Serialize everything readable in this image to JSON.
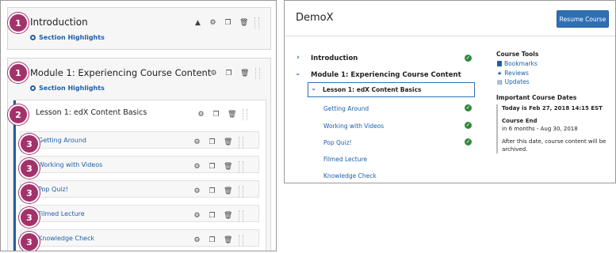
{
  "studio": {
    "section": {
      "badge": "1",
      "title": "Introduction",
      "highlights": "Section Highlights"
    },
    "module": {
      "badge": "1",
      "title": "Module 1: Experiencing Course Content",
      "highlights": "Section Highlights"
    },
    "lesson": {
      "badge": "2",
      "title": "Lesson 1: edX Content Basics"
    },
    "units": [
      {
        "badge": "3",
        "title": "Getting Around"
      },
      {
        "badge": "3",
        "title": "Working with Videos"
      },
      {
        "badge": "3",
        "title": "Pop Quiz!"
      },
      {
        "badge": "3",
        "title": "Filmed Lecture"
      },
      {
        "badge": "3",
        "title": "Knowledge Check"
      }
    ]
  },
  "lms": {
    "course_title": "DemoX",
    "resume_label": "Resume Course",
    "outline": {
      "intro": "Introduction",
      "module": "Module 1: Experiencing Course Content",
      "lesson": "Lesson 1: edX Content Basics",
      "units": [
        "Getting Around",
        "Working with Videos",
        "Pop Quiz!",
        "Filmed Lecture",
        "Knowledge Check"
      ]
    },
    "tools": {
      "heading": "Course Tools",
      "items": [
        "Bookmarks",
        "Reviews",
        "Updates"
      ]
    },
    "dates": {
      "heading": "Important Course Dates",
      "today": "Today is Feb 27, 2018 14:15 EST",
      "end_label": "Course End",
      "end_value": "in 6 months - Aug 30, 2018",
      "note": "After this date, course content will be archived."
    }
  },
  "colors": {
    "badge": "#a3326b",
    "link": "#1d5ea8",
    "complete": "#2f8a3a",
    "button": "#2f6fb4"
  }
}
